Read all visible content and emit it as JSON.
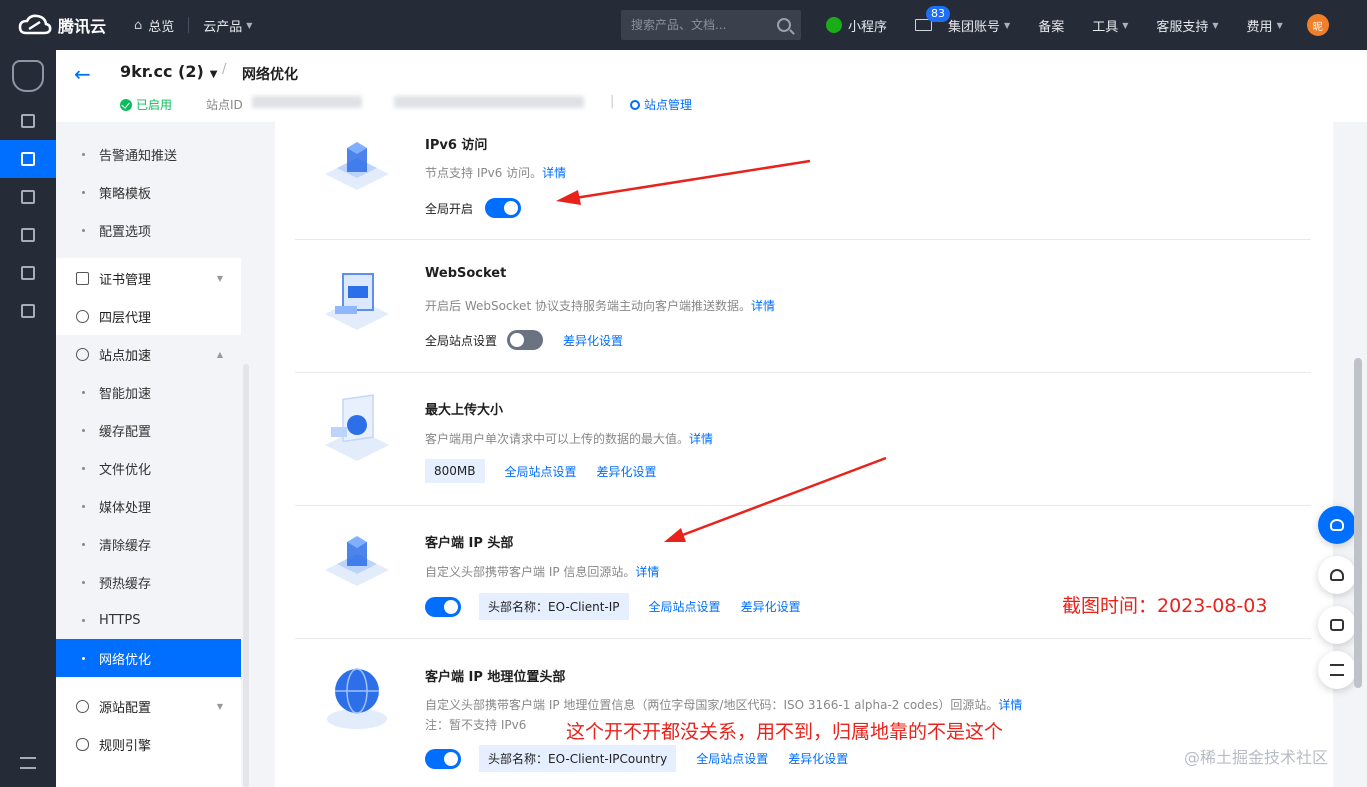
{
  "topbar": {
    "brand": "腾讯云",
    "overview": "总览",
    "products": "云产品",
    "search_placeholder": "搜索产品、文档...",
    "mini_program": "小程序",
    "mail_badge": "83",
    "group_account": "集团账号",
    "beian": "备案",
    "tools": "工具",
    "support": "客服支持",
    "billing": "费用",
    "avatar_text": "昵"
  },
  "header": {
    "site_name": "9kr.cc (2)",
    "page_title": "网络优化",
    "status": "已启用",
    "site_id_label": "站点ID",
    "site_mgmt": "站点管理"
  },
  "sidemenu": {
    "items_top": [
      {
        "label": "告警通知推送"
      },
      {
        "label": "策略模板"
      },
      {
        "label": "配置选项"
      }
    ],
    "cert": "证书管理",
    "l4": "四层代理",
    "accel": "站点加速",
    "accel_items": [
      {
        "label": "智能加速"
      },
      {
        "label": "缓存配置"
      },
      {
        "label": "文件优化"
      },
      {
        "label": "媒体处理"
      },
      {
        "label": "清除缓存"
      },
      {
        "label": "预热缓存"
      },
      {
        "label": "HTTPS"
      },
      {
        "label": "网络优化"
      }
    ],
    "origin": "源站配置",
    "rules": "规则引擎"
  },
  "sections": {
    "ipv6": {
      "title": "IPv6 访问",
      "desc": "节点支持 IPv6 访问。",
      "detail": "详情",
      "toggle_label": "全局开启",
      "enabled": true
    },
    "websocket": {
      "title": "WebSocket",
      "desc": "开启后 WebSocket 协议支持服务端主动向客户端推送数据。",
      "detail": "详情",
      "toggle_label": "全局站点设置",
      "enabled": false,
      "diff": "差异化设置"
    },
    "upload": {
      "title": "最大上传大小",
      "desc": "客户端用户单次请求中可以上传的数据的最大值。",
      "detail": "详情",
      "value": "800MB",
      "global": "全局站点设置",
      "diff": "差异化设置"
    },
    "client_ip": {
      "title": "客户端 IP 头部",
      "desc": "自定义头部携带客户端 IP 信息回源站。",
      "detail": "详情",
      "enabled": true,
      "header_name": "头部名称：EO-Client-IP",
      "global": "全局站点设置",
      "diff": "差异化设置"
    },
    "client_geo": {
      "title": "客户端 IP 地理位置头部",
      "desc": "自定义头部携带客户端 IP 地理位置信息（两位字母国家/地区代码：ISO 3166-1 alpha-2 codes）回源站。",
      "detail": "详情",
      "note": "注：暂不支持 IPv6",
      "enabled": true,
      "header_name": "头部名称：EO-Client-IPCountry",
      "global": "全局站点设置",
      "diff": "差异化设置"
    }
  },
  "annotations": {
    "screenshot_time": "截图时间：2023-08-03",
    "comment": "这个开不开都没关系，用不到，归属地靠的不是这个",
    "watermark": "@稀土掘金技术社区"
  },
  "colors": {
    "accent": "#006eff",
    "topbar_bg": "#262c37",
    "annotation_red": "#e8231b",
    "status_green": "#0abf5b"
  }
}
